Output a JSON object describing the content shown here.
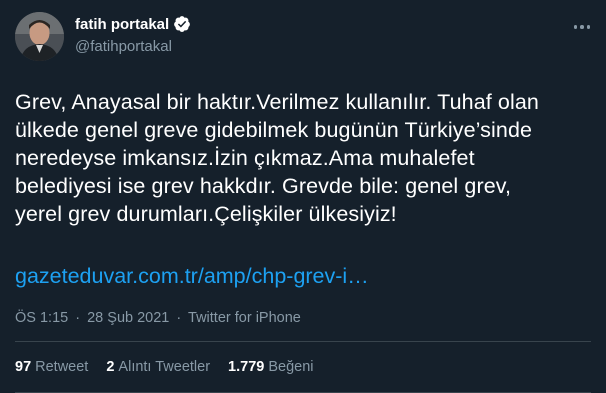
{
  "author": {
    "display_name": "fatih portakal",
    "handle": "@fatihportakal",
    "verified": true
  },
  "tweet": {
    "text": "Grev, Anayasal bir haktır.Verilmez kullanılır. Tuhaf olan\nülkede genel greve gidebilmek bugünün Türkiye’sinde\nneredeyse imkansız.İzin çıkmaz.Ama muhalefet\nbelediyesi ise grev hakkdır. Grevde bile: genel grev,\nyerel grev durumları.Çelişkiler ülkesiyiz!",
    "link": "gazeteduvar.com.tr/amp/chp-grev-i…",
    "time": "ÖS 1:15",
    "date": "28 Şub 2021",
    "source": "Twitter for iPhone",
    "separator": "·"
  },
  "stats": {
    "retweets_count": "97",
    "retweets_label": "Retweet",
    "quotes_count": "2",
    "quotes_label": "Alıntı Tweetler",
    "likes_count": "1.779",
    "likes_label": "Beğeni"
  },
  "colors": {
    "background": "#15202b",
    "link": "#1da1f2",
    "muted": "#8899a6",
    "divider": "#38444d"
  }
}
